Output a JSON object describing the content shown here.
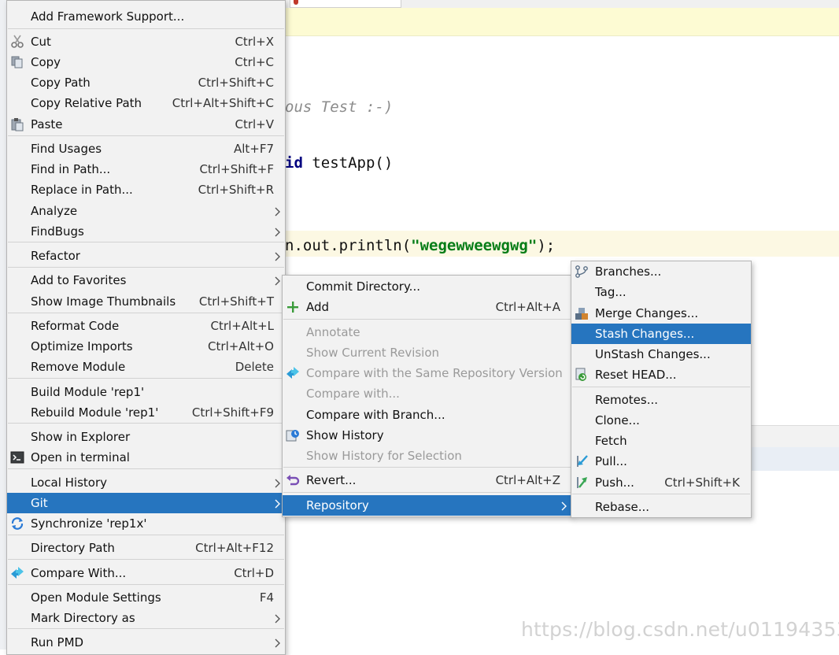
{
  "editor": {
    "comment_text": "ous Test :-)",
    "method_keyword": "id",
    "method_rest": " testApp()",
    "println_prefix": "n.out.println(",
    "println_string": "\"wegewweewgwg\"",
    "println_suffix": ");"
  },
  "watermark": "https://blog.csdn.net/u011943534",
  "main_menu": {
    "items": [
      {
        "label": "Add Framework Support...",
        "shortcut": "",
        "icon": ""
      },
      {
        "label": "Cut",
        "shortcut": "Ctrl+X",
        "icon": "scissors-icon"
      },
      {
        "label": "Copy",
        "shortcut": "Ctrl+C",
        "icon": "copy-icon"
      },
      {
        "label": "Copy Path",
        "shortcut": "Ctrl+Shift+C",
        "icon": ""
      },
      {
        "label": "Copy Relative Path",
        "shortcut": "Ctrl+Alt+Shift+C",
        "icon": ""
      },
      {
        "label": "Paste",
        "shortcut": "Ctrl+V",
        "icon": "paste-icon"
      },
      {
        "label": "Find Usages",
        "shortcut": "Alt+F7",
        "icon": ""
      },
      {
        "label": "Find in Path...",
        "shortcut": "Ctrl+Shift+F",
        "icon": ""
      },
      {
        "label": "Replace in Path...",
        "shortcut": "Ctrl+Shift+R",
        "icon": ""
      },
      {
        "label": "Analyze",
        "shortcut": "",
        "icon": ""
      },
      {
        "label": "FindBugs",
        "shortcut": "",
        "icon": ""
      },
      {
        "label": "Refactor",
        "shortcut": "",
        "icon": ""
      },
      {
        "label": "Add to Favorites",
        "shortcut": "",
        "icon": ""
      },
      {
        "label": "Show Image Thumbnails",
        "shortcut": "Ctrl+Shift+T",
        "icon": ""
      },
      {
        "label": "Reformat Code",
        "shortcut": "Ctrl+Alt+L",
        "icon": ""
      },
      {
        "label": "Optimize Imports",
        "shortcut": "Ctrl+Alt+O",
        "icon": ""
      },
      {
        "label": "Remove Module",
        "shortcut": "Delete",
        "icon": ""
      },
      {
        "label": "Build Module 'rep1'",
        "shortcut": "",
        "icon": ""
      },
      {
        "label": "Rebuild Module 'rep1'",
        "shortcut": "Ctrl+Shift+F9",
        "icon": ""
      },
      {
        "label": "Show in Explorer",
        "shortcut": "",
        "icon": ""
      },
      {
        "label": "Open in terminal",
        "shortcut": "",
        "icon": "terminal-icon"
      },
      {
        "label": "Local History",
        "shortcut": "",
        "icon": ""
      },
      {
        "label": "Git",
        "shortcut": "",
        "icon": ""
      },
      {
        "label": "Synchronize 'rep1x'",
        "shortcut": "",
        "icon": "sync-icon"
      },
      {
        "label": "Directory Path",
        "shortcut": "Ctrl+Alt+F12",
        "icon": ""
      },
      {
        "label": "Compare With...",
        "shortcut": "Ctrl+D",
        "icon": "compare-icon"
      },
      {
        "label": "Open Module Settings",
        "shortcut": "F4",
        "icon": ""
      },
      {
        "label": "Mark Directory as",
        "shortcut": "",
        "icon": ""
      },
      {
        "label": "Run PMD",
        "shortcut": "",
        "icon": ""
      }
    ]
  },
  "git_menu": {
    "items": [
      {
        "label": "Commit Directory...",
        "shortcut": "",
        "icon": ""
      },
      {
        "label": "Add",
        "shortcut": "Ctrl+Alt+A",
        "icon": "plus-icon"
      },
      {
        "label": "Annotate",
        "shortcut": "",
        "icon": ""
      },
      {
        "label": "Show Current Revision",
        "shortcut": "",
        "icon": ""
      },
      {
        "label": "Compare with the Same Repository Version",
        "shortcut": "",
        "icon": "compare-icon"
      },
      {
        "label": "Compare with...",
        "shortcut": "",
        "icon": ""
      },
      {
        "label": "Compare with Branch...",
        "shortcut": "",
        "icon": ""
      },
      {
        "label": "Show History",
        "shortcut": "",
        "icon": "history-icon"
      },
      {
        "label": "Show History for Selection",
        "shortcut": "",
        "icon": ""
      },
      {
        "label": "Revert...",
        "shortcut": "Ctrl+Alt+Z",
        "icon": "revert-icon"
      },
      {
        "label": "Repository",
        "shortcut": "",
        "icon": ""
      }
    ]
  },
  "repo_menu": {
    "items": [
      {
        "label": "Branches...",
        "shortcut": "",
        "icon": "branch-icon"
      },
      {
        "label": "Tag...",
        "shortcut": "",
        "icon": ""
      },
      {
        "label": "Merge Changes...",
        "shortcut": "",
        "icon": "merge-icon"
      },
      {
        "label": "Stash Changes...",
        "shortcut": "",
        "icon": ""
      },
      {
        "label": "UnStash Changes...",
        "shortcut": "",
        "icon": ""
      },
      {
        "label": "Reset HEAD...",
        "shortcut": "",
        "icon": "reset-icon"
      },
      {
        "label": "Remotes...",
        "shortcut": "",
        "icon": ""
      },
      {
        "label": "Clone...",
        "shortcut": "",
        "icon": ""
      },
      {
        "label": "Fetch",
        "shortcut": "",
        "icon": ""
      },
      {
        "label": "Pull...",
        "shortcut": "",
        "icon": "pull-icon"
      },
      {
        "label": "Push...",
        "shortcut": "Ctrl+Shift+K",
        "icon": "push-icon"
      },
      {
        "label": "Rebase...",
        "shortcut": "",
        "icon": ""
      }
    ]
  },
  "colors": {
    "selection": "#2675bf",
    "menu_bg": "#f2f2f2",
    "string": "#067d17",
    "keyword": "#000080"
  }
}
